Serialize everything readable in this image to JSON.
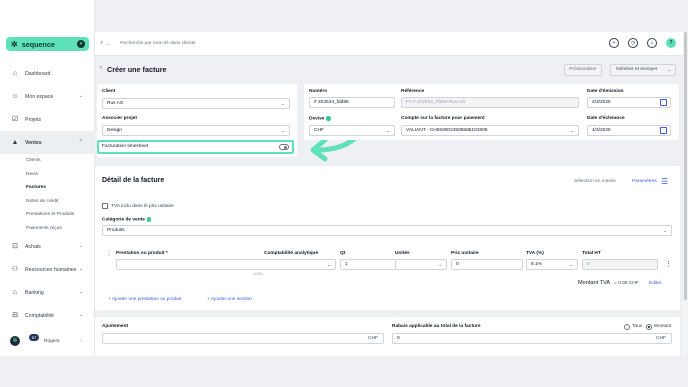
{
  "app": {
    "logo_text": "sequence"
  },
  "sidebar": {
    "items": [
      {
        "label": "Dashboard",
        "icon": "home-icon"
      },
      {
        "label": "Mon espace",
        "icon": "user-icon"
      },
      {
        "label": "Projets",
        "icon": "check-square-icon"
      },
      {
        "label": "Ventes",
        "icon": "ventes-icon"
      },
      {
        "label": "Achats",
        "icon": "cart-icon"
      },
      {
        "label": "Ressources humaines",
        "icon": "people-icon"
      },
      {
        "label": "Banking",
        "icon": "bank-icon"
      },
      {
        "label": "Comptabilité",
        "icon": "ledger-icon"
      }
    ],
    "sub_items": [
      "Clients",
      "Devis",
      "Factures",
      "Notes de crédit",
      "Prestations et Produits",
      "Paiements reçus"
    ],
    "user": {
      "name": "Rogers",
      "badge": "57"
    }
  },
  "topbar": {
    "search_placeholder": "Recherche par mot-clé dans clients"
  },
  "header": {
    "title": "Créer une facture",
    "preview_button": "Prévisualiser",
    "generate_button": "Générer et envoyer"
  },
  "form": {
    "client_label": "Client",
    "client_value": "Rus AG",
    "project_label": "Associer projet",
    "project_value": "Design",
    "timesheet_label": "Facturation timesheet",
    "numero_label": "Numéro",
    "numero_value": "# 202534_fdd88",
    "reference_label": "Référence",
    "reference_value": "FA # 202534_fdd88 Rus AG",
    "emission_label": "Date d'émission",
    "emission_value": "4/3/2025",
    "devise_label": "Devise",
    "devise_value": "CHF",
    "compte_label": "Compte sur la facture pour paiement",
    "compte_value": "VALIANT - CH5930024505585101908",
    "echeance_label": "Date d'échéance",
    "echeance_value": "4/3/2025"
  },
  "detail": {
    "title": "Détail de la facture",
    "selection_label": "Sélection en masse",
    "params_label": "Paramètres",
    "tva_checkbox_label": "TVA inclu dans le prix unitaire",
    "category_label": "Catégorie de vente",
    "category_value": "Produits",
    "columns": [
      "Prestation ou produit *",
      "Comptabilité analytique",
      "Qt",
      "Unités",
      "Prix unitaire",
      "TVA (%)",
      "Total HT"
    ],
    "row": {
      "qty": "1",
      "unit_price": "0",
      "tva": "8.1%",
      "total": "0"
    },
    "counter": "0/255",
    "montant_tva_label": "Montant TVA",
    "montant_tva_value": "= 0.00 CHF",
    "edit_link": "Editer",
    "add_line": "Ajouter une prestation ou produit",
    "add_section": "Ajouter une section"
  },
  "footer_form": {
    "adjust_label": "Ajustement",
    "adjust_currency": "CHF",
    "rabais_label": "Rabais applicable au total de la facture",
    "rabais_value": "0",
    "rabais_currency": "CHF",
    "radio_taux": "Taux",
    "radio_montant": "Montant"
  },
  "colors": {
    "accent": "#5ee0b8",
    "link": "#3b5bdb"
  }
}
